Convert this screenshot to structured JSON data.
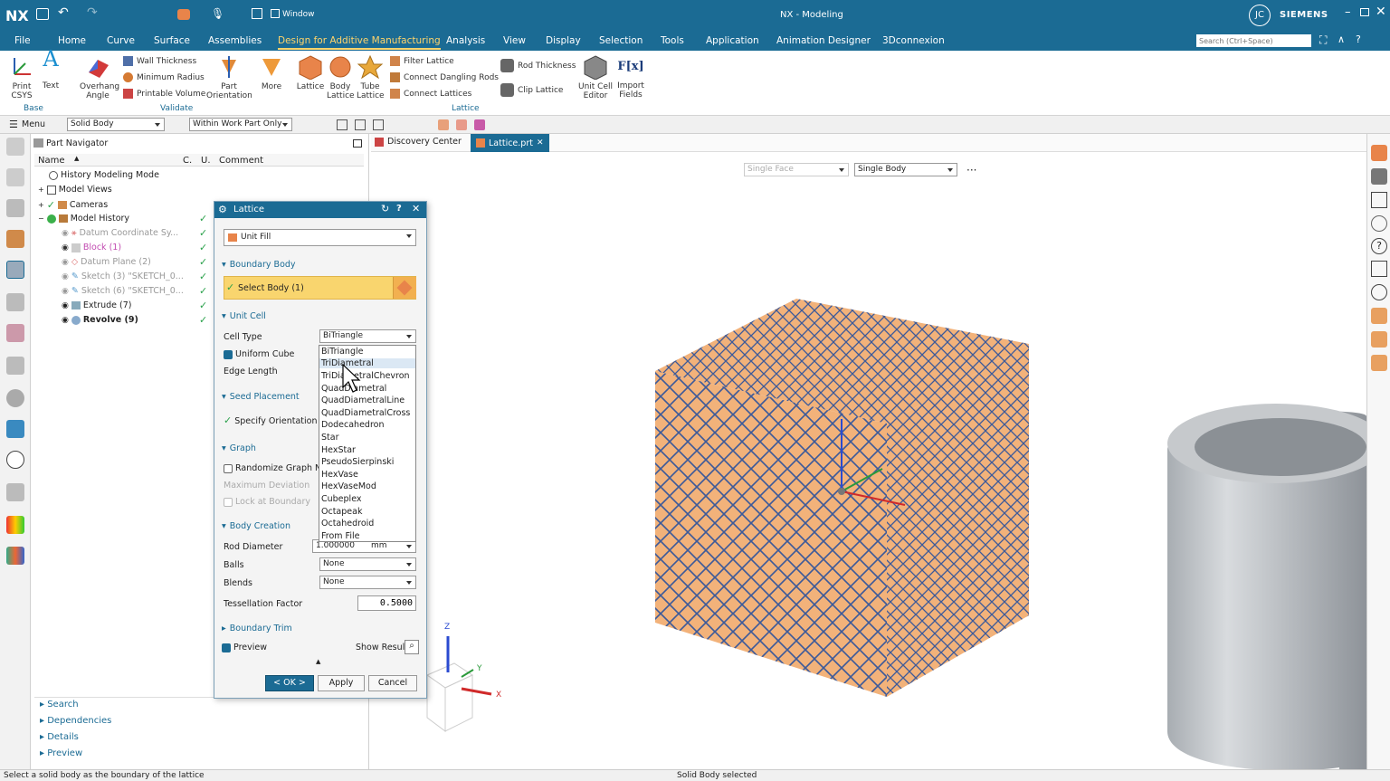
{
  "app": {
    "logo": "NX",
    "title": "NX - Modeling",
    "user_initials": "JC",
    "brand": "SIEMENS",
    "window_menu": "Window",
    "search_placeholder": "Search (Ctrl+Space)"
  },
  "menu": [
    "File",
    "Home",
    "Curve",
    "Surface",
    "Assemblies",
    "Design for Additive Manufacturing",
    "Analysis",
    "View",
    "Display",
    "Selection",
    "Tools",
    "Application",
    "Animation Designer",
    "3Dconnexion"
  ],
  "ribbon": {
    "base": {
      "label": "Base",
      "print_csys": "Print CSYS",
      "text": "Text"
    },
    "validate": {
      "label": "Validate",
      "overhang": "Overhang Angle",
      "wall_thickness": "Wall Thickness",
      "min_radius": "Minimum Radius",
      "printable_volume": "Printable Volume",
      "part_orientation": "Part Orientation",
      "more": "More"
    },
    "lattice": {
      "label": "Lattice",
      "lattice": "Lattice",
      "body_lattice": "Body Lattice",
      "tube_lattice": "Tube Lattice",
      "filter_lattice": "Filter Lattice",
      "connect_dangling": "Connect Dangling Rods",
      "connect_lattices": "Connect Lattices",
      "rod_thickness": "Rod Thickness",
      "clip_lattice": "Clip Lattice",
      "unit_cell_editor": "Unit Cell Editor",
      "import_fields": "Import Fields",
      "fx": "F[x]"
    }
  },
  "selbar": {
    "menu": "Menu",
    "filter": "Solid Body",
    "scope": "Within Work Part Only"
  },
  "navigator": {
    "title": "Part Navigator",
    "cols": {
      "name": "Name",
      "c": "C.",
      "u": "U.",
      "comment": "Comment"
    },
    "rows": [
      "History Modeling Mode",
      "Model Views",
      "Cameras",
      "Model History",
      "Datum Coordinate Sy...",
      "Block (1)",
      "Datum Plane (2)",
      "Sketch (3) \"SKETCH_0...",
      "Sketch (6) \"SKETCH_0...",
      "Extrude (7)",
      "Revolve (9)"
    ],
    "bottom": [
      "Search",
      "Dependencies",
      "Details",
      "Preview"
    ]
  },
  "tabs": {
    "discovery": "Discovery Center",
    "lattice": "Lattice.prt"
  },
  "viewport": {
    "face_filter": "Single Face",
    "body_filter": "Single Body",
    "more": "···",
    "axis_x": "X",
    "axis_y": "Y",
    "axis_z": "Z"
  },
  "dialog": {
    "title": "Lattice",
    "type": "Unit Fill",
    "boundary_body": "Boundary Body",
    "select_body": "Select Body (1)",
    "unit_cell": "Unit Cell",
    "cell_type_label": "Cell Type",
    "cell_type_value": "BiTriangle",
    "uniform_cube": "Uniform Cube",
    "edge_length": "Edge Length",
    "seed_placement": "Seed Placement",
    "specify_orientation": "Specify Orientation",
    "graph": "Graph",
    "randomize": "Randomize Graph No",
    "max_deviation": "Maximum Deviation",
    "lock_boundary": "Lock at Boundary",
    "body_creation": "Body Creation",
    "rod_diameter": "Rod Diameter",
    "rod_value": "1.000000",
    "rod_unit": "mm",
    "balls": "Balls",
    "balls_value": "None",
    "blends": "Blends",
    "blends_value": "None",
    "tessellation": "Tessellation Factor",
    "tessellation_value": "0.5000",
    "boundary_trim": "Boundary Trim",
    "preview": "Preview",
    "show_result": "Show Result",
    "ok": "< OK >",
    "apply": "Apply",
    "cancel": "Cancel",
    "cell_options": [
      "BiTriangle",
      "TriDiametral",
      "TriDiametralChevron",
      "QuadDiametral",
      "QuadDiametralLine",
      "QuadDiametralCross",
      "Dodecahedron",
      "Star",
      "HexStar",
      "PseudoSierpinski",
      "HexVase",
      "HexVaseMod",
      "Cubeplex",
      "Octapeak",
      "Octahedroid",
      "From File"
    ],
    "highlighted": "TriDiametral"
  },
  "status": {
    "left": "Select a solid body as the boundary of the lattice",
    "center": "Solid Body selected"
  },
  "colors": {
    "accent": "#1b6b94",
    "lattice_fill": "#f2b27a",
    "lattice_rod": "#3c5a9a",
    "select_highlight": "#f9d56e"
  }
}
